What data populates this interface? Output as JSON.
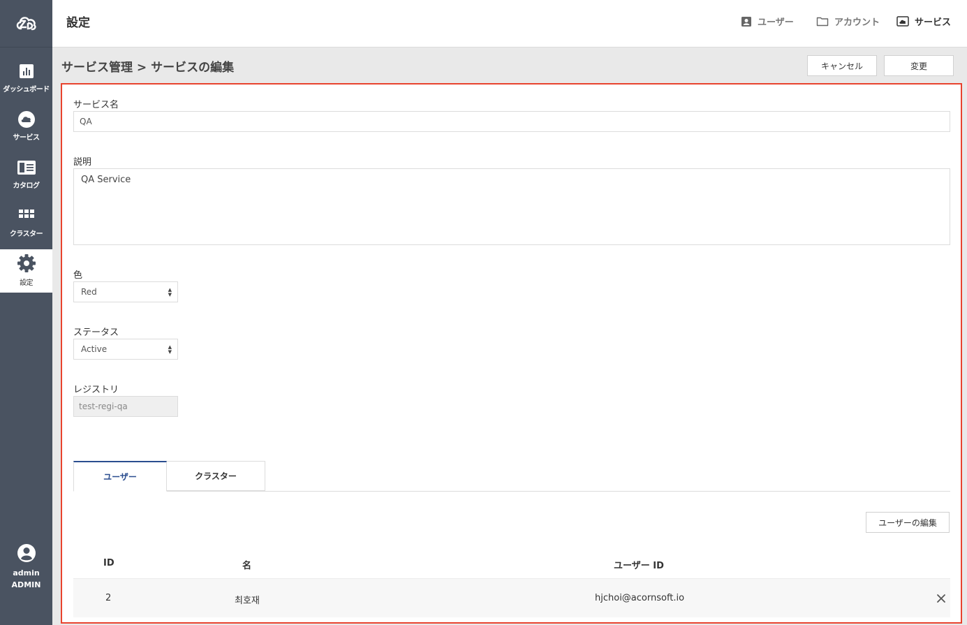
{
  "sidebar": {
    "logo": "ZD",
    "items": [
      {
        "label": "ダッシュボード",
        "icon": "dashboard-icon"
      },
      {
        "label": "サービス",
        "icon": "cloud-icon"
      },
      {
        "label": "カタログ",
        "icon": "catalog-icon"
      },
      {
        "label": "クラスター",
        "icon": "grid-icon"
      },
      {
        "label": "設定",
        "icon": "gear-icon"
      }
    ],
    "user": {
      "name": "admin",
      "role": "ADMIN"
    }
  },
  "header": {
    "title": "設定",
    "nav": [
      {
        "label": "ユーザー",
        "icon": "user-card-icon"
      },
      {
        "label": "アカウント",
        "icon": "folder-icon"
      },
      {
        "label": "サービス",
        "icon": "cloud-box-icon"
      }
    ]
  },
  "subheader": {
    "breadcrumb": "サービス管理 > サービスの編集",
    "cancel_label": "キャンセル",
    "submit_label": "変更"
  },
  "form": {
    "name_label": "サービス名",
    "name_value": "QA",
    "desc_label": "説明",
    "desc_value": "QA Service",
    "color_label": "色",
    "color_value": "Red",
    "status_label": "ステータス",
    "status_value": "Active",
    "registry_label": "レジストリ",
    "registry_value": "test-regi-qa"
  },
  "tabs": [
    {
      "label": "ユーザー",
      "active": true
    },
    {
      "label": "クラスター",
      "active": false
    }
  ],
  "users": {
    "edit_label": "ユーザーの編集",
    "columns": [
      "ID",
      "名",
      "ユーザー ID"
    ],
    "rows": [
      {
        "id": "2",
        "name": "최호재",
        "user_id": "hjchoi@acornsoft.io"
      }
    ]
  },
  "colors": {
    "sidebar_bg": "#4a5361",
    "highlight_border": "#e8432e",
    "tab_accent": "#2a4d8f"
  }
}
